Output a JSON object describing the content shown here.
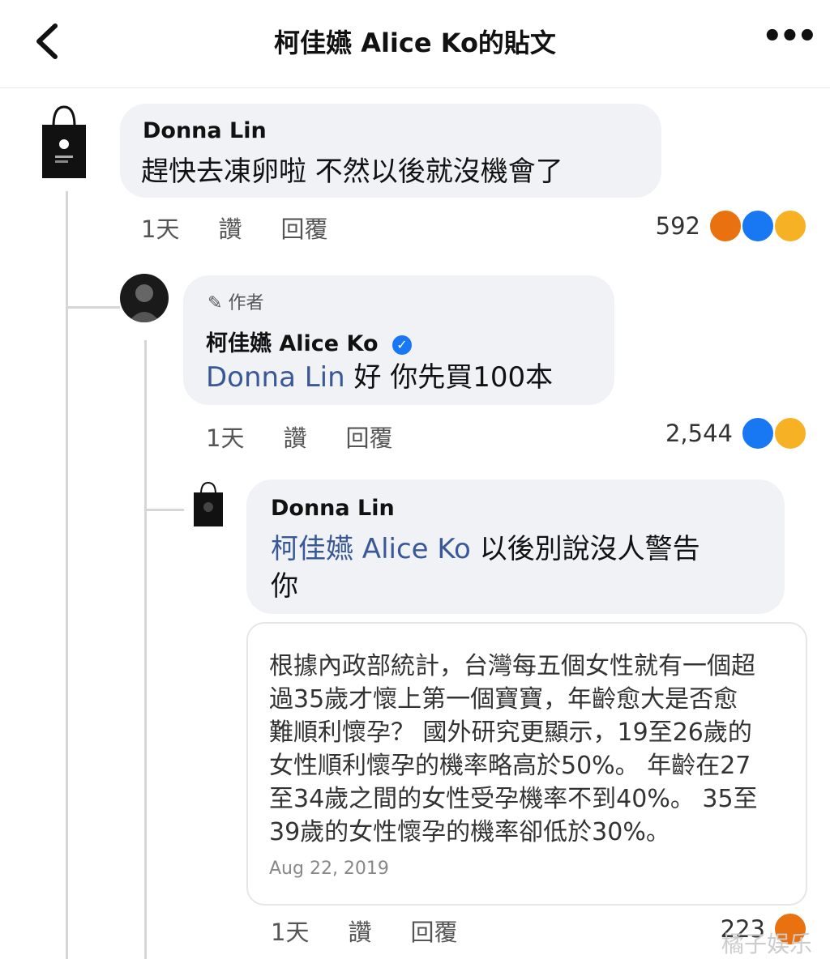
{
  "header": {
    "title": "柯佳嬿 Alice Ko的貼文"
  },
  "comments": [
    {
      "author": "Donna Lin",
      "text": "趕快去凍卵啦 不然以後就沒機會了",
      "time": "1天",
      "action_read": "讚",
      "action_reply": "回覆",
      "reaction_count": "592",
      "reactions": [
        "angry-icon",
        "like-icon",
        "haha-icon"
      ]
    },
    {
      "badge": "作者",
      "author": "柯佳嬿 Alice Ko",
      "mention": "Donna Lin",
      "text": " 好 你先買100本",
      "time": "1天",
      "action_read": "讚",
      "action_reply": "回覆",
      "reaction_count": "2,544",
      "reactions": [
        "like-icon",
        "haha-icon"
      ]
    },
    {
      "author": "Donna Lin",
      "mention": "柯佳嬿 Alice Ko",
      "text_line1": " 以後別說沒人警告",
      "text_line2": "你",
      "quote": {
        "lines": [
          "根據內政部統計，台灣每五個女性就有一個超",
          "過35歲才懷上第一個寶寶，年齡愈大是否愈",
          "難順利懷孕？ 國外研究更顯示，19至26歲的",
          "女性順利懷孕的機率略高於50%。 年齡在27",
          "至34歲之間的女性受孕機率不到40%。 35至",
          "39歲的女性懷孕的機率卻低於30%。"
        ],
        "date": "Aug 22, 2019"
      },
      "time": "1天",
      "action_read": "讚",
      "action_reply": "回覆",
      "reaction_count": "223",
      "reactions": [
        "angry-icon"
      ]
    }
  ],
  "watermark": "橘子娱乐"
}
